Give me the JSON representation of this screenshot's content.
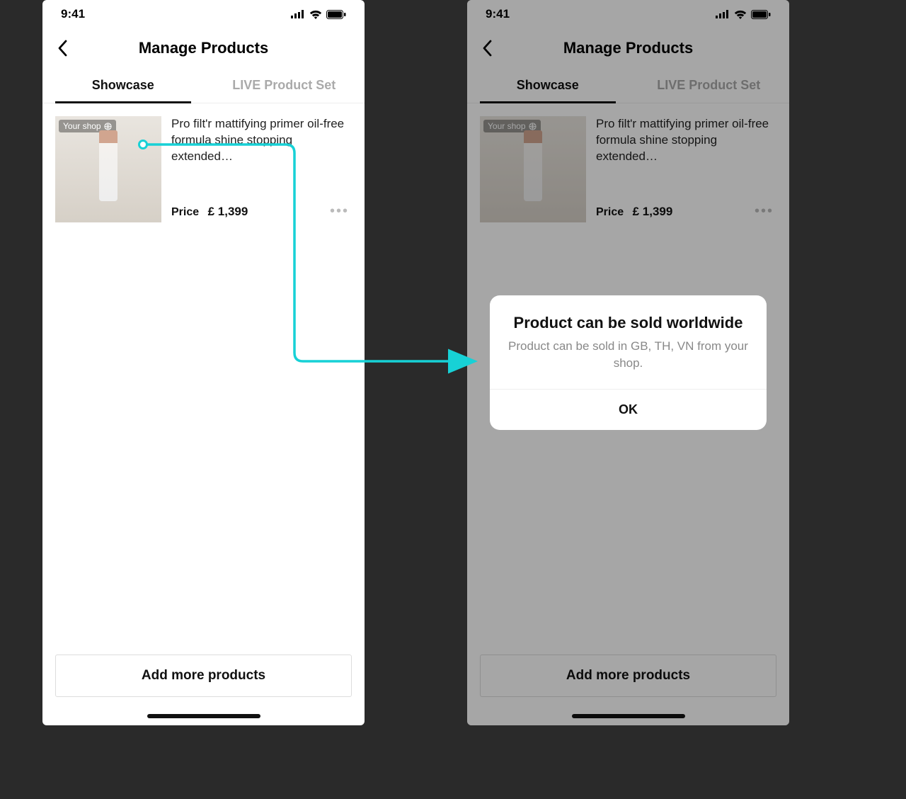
{
  "statusbar": {
    "time": "9:41"
  },
  "nav": {
    "title": "Manage Products"
  },
  "tabs": [
    {
      "label": "Showcase",
      "active": true
    },
    {
      "label": "LIVE Product Set",
      "active": false
    }
  ],
  "product": {
    "badge": "Your shop",
    "title": "Pro filt'r mattifying primer oil-free formula shine stopping extended…",
    "price_label": "Price",
    "price_value": "£ 1,399"
  },
  "buttons": {
    "add_more": "Add more products"
  },
  "modal": {
    "title": "Product can be sold worldwide",
    "body": "Product can be sold in GB, TH, VN from your shop.",
    "ok": "OK"
  },
  "annotation": {
    "accent": "#17d1d6"
  }
}
